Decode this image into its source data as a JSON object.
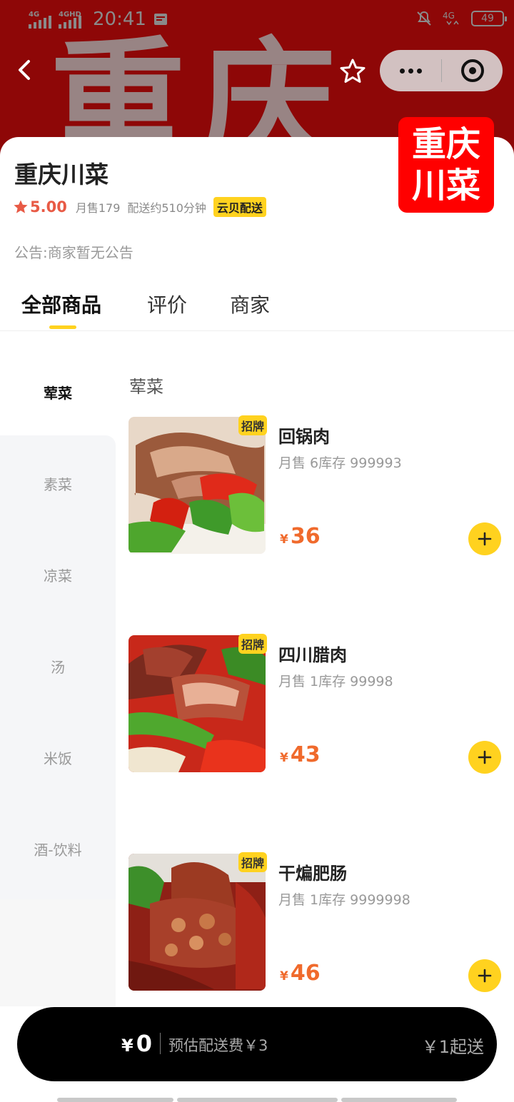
{
  "status_bar": {
    "network1": "4G",
    "network2": "4GHD",
    "time": "20:41",
    "network3": "4G",
    "battery": "49"
  },
  "header": {
    "banner_text": "重庆",
    "store_logo_line1": "重庆",
    "store_logo_line2": "川菜"
  },
  "store": {
    "name": "重庆川菜",
    "rating": "5.00",
    "monthly_sales": "月售179",
    "delivery_time": "配送约510分钟",
    "delivery_tag": "云贝配送",
    "notice": "公告:商家暂无公告"
  },
  "tabs": [
    {
      "label": "全部商品",
      "active": true
    },
    {
      "label": "评价",
      "active": false
    },
    {
      "label": "商家",
      "active": false
    }
  ],
  "categories": [
    {
      "label": "荤菜",
      "active": true
    },
    {
      "label": "素菜",
      "active": false
    },
    {
      "label": "凉菜",
      "active": false
    },
    {
      "label": "汤",
      "active": false
    },
    {
      "label": "米饭",
      "active": false
    },
    {
      "label": "酒-饮料",
      "active": false
    }
  ],
  "section": {
    "title": "荤菜"
  },
  "products": [
    {
      "badge": "招牌",
      "name": "回锅肉",
      "meta": "月售 6库存 999993",
      "currency": "¥",
      "price": "36"
    },
    {
      "badge": "招牌",
      "name": "四川腊肉",
      "meta": "月售 1库存 99998",
      "currency": "¥",
      "price": "43"
    },
    {
      "badge": "招牌",
      "name": "干煸肥肠",
      "meta": "月售 1库存 9999998",
      "currency": "¥",
      "price": "46"
    }
  ],
  "cart": {
    "currency": "¥",
    "total": "0",
    "delivery_fee": "预估配送费￥3",
    "min_order": "￥1起送"
  },
  "colors": {
    "banner": "#8e0707",
    "accent_yellow": "#ffd21f",
    "price_orange": "#f06a2c",
    "rating_red": "#e85a45",
    "logo_red": "#ff0000",
    "cart_bg": "#000000"
  }
}
